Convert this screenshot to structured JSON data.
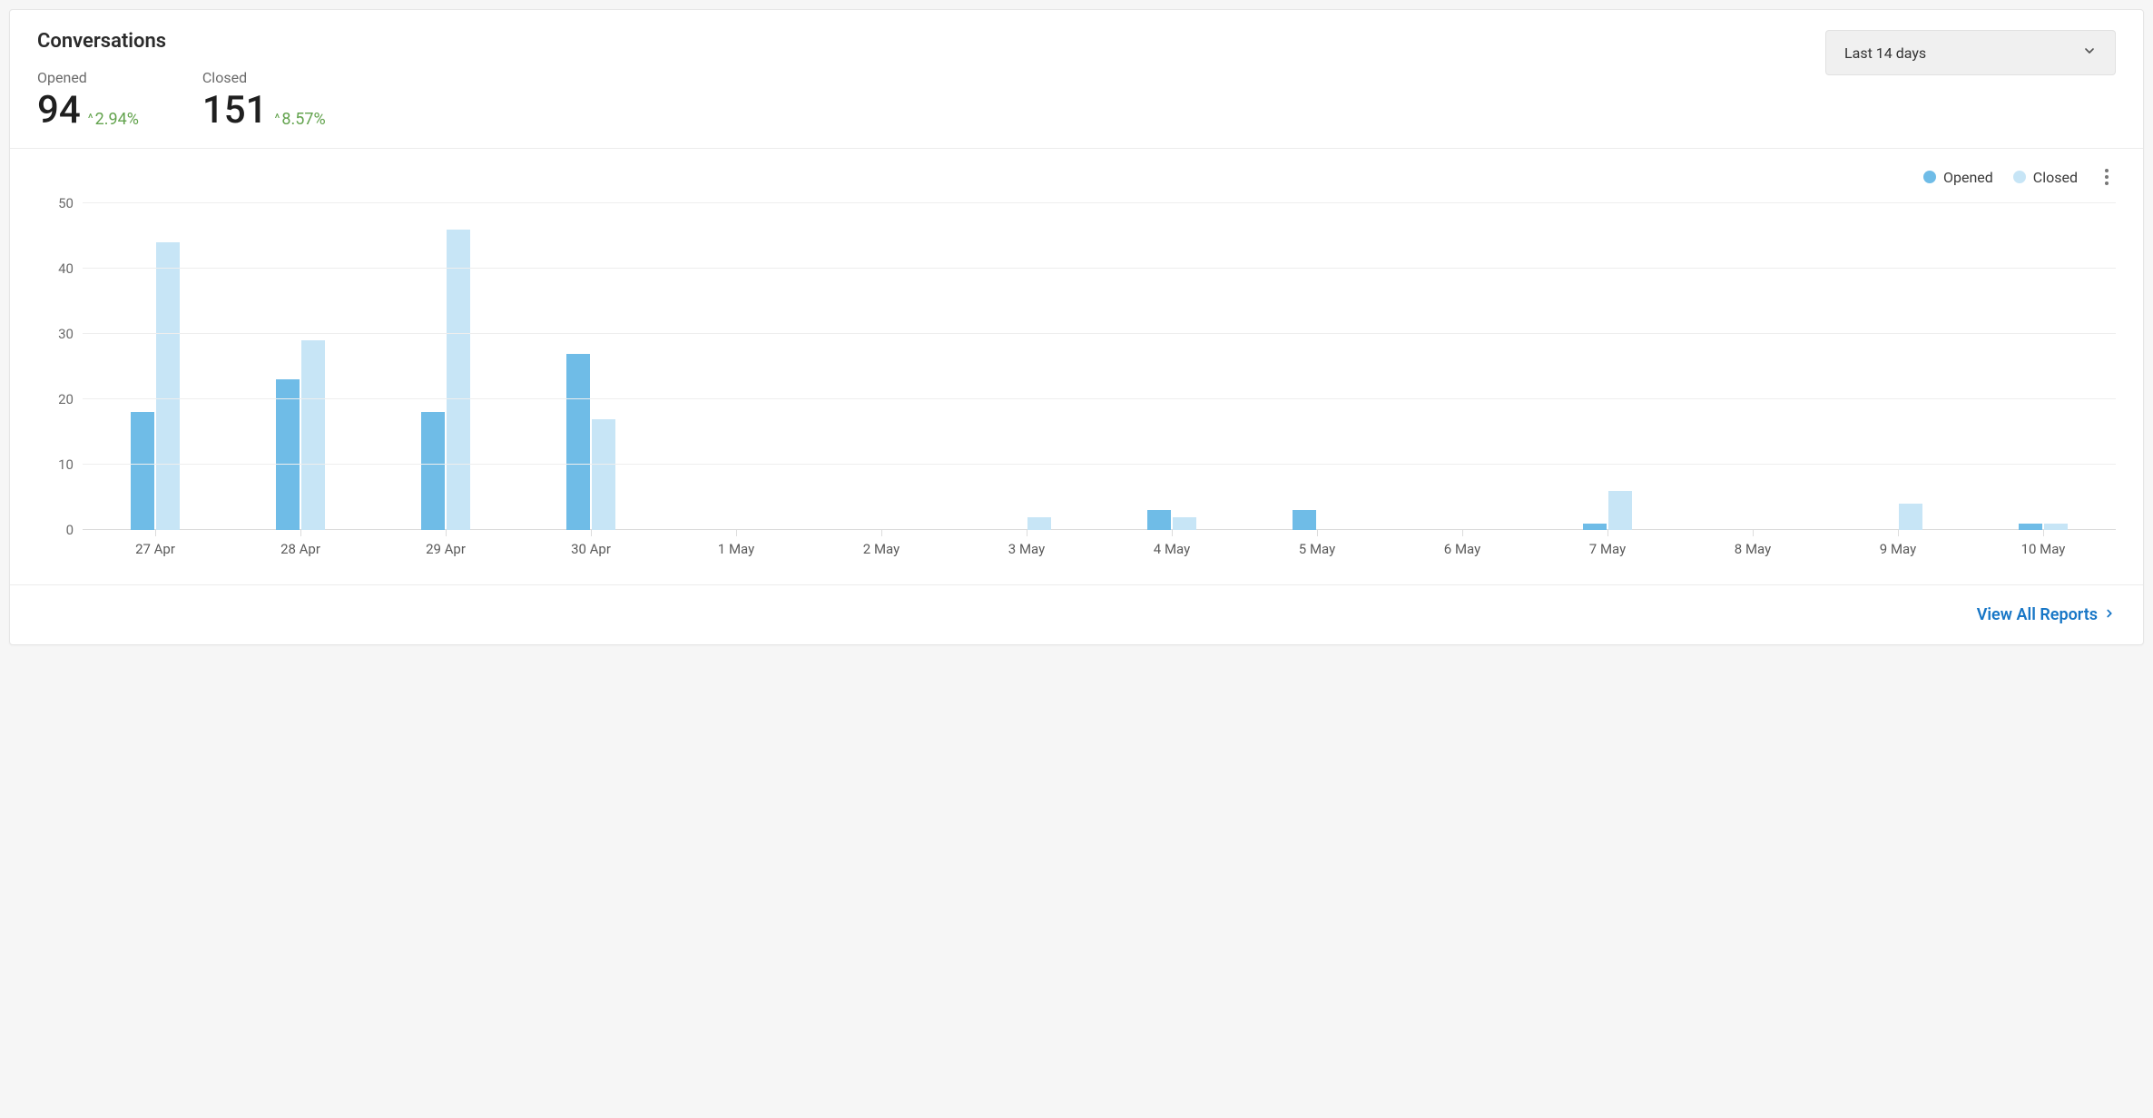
{
  "header": {
    "title": "Conversations",
    "dropdown_label": "Last 14 days"
  },
  "metrics": {
    "opened": {
      "label": "Opened",
      "value": "94",
      "change": "2.94%",
      "direction": "up"
    },
    "closed": {
      "label": "Closed",
      "value": "151",
      "change": "8.57%",
      "direction": "up"
    }
  },
  "legend": {
    "opened": "Opened",
    "closed": "Closed"
  },
  "colors": {
    "opened": "#6fbce7",
    "closed": "#c7e5f6",
    "trend_up": "#63a34e",
    "link": "#1776c6"
  },
  "footer": {
    "view_all": "View All Reports"
  },
  "chart_data": {
    "type": "bar",
    "categories": [
      "27 Apr",
      "28 Apr",
      "29 Apr",
      "30 Apr",
      "1 May",
      "2 May",
      "3 May",
      "4 May",
      "5 May",
      "6 May",
      "7 May",
      "8 May",
      "9 May",
      "10 May"
    ],
    "series": [
      {
        "name": "Opened",
        "values": [
          18,
          23,
          18,
          27,
          0,
          0,
          0,
          3,
          3,
          0,
          1,
          0,
          0,
          1
        ]
      },
      {
        "name": "Closed",
        "values": [
          44,
          29,
          46,
          17,
          0,
          0,
          2,
          2,
          0,
          0,
          6,
          0,
          4,
          1
        ]
      }
    ],
    "ylim": [
      0,
      50
    ],
    "yticks": [
      0,
      10,
      20,
      30,
      40,
      50
    ],
    "xlabel": "",
    "ylabel": "",
    "title": ""
  }
}
